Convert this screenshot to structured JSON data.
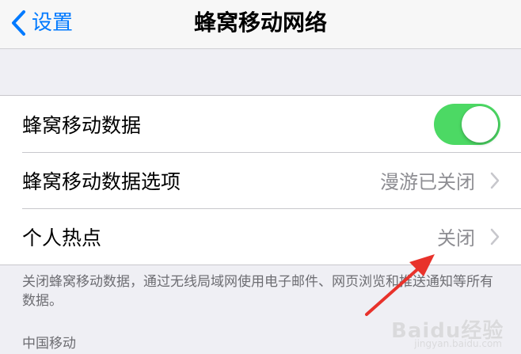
{
  "navbar": {
    "back_label": "设置",
    "title": "蜂窝移动网络"
  },
  "cellular": {
    "rows": [
      {
        "label": "蜂窝移动数据",
        "toggle_on": true
      },
      {
        "label": "蜂窝移动数据选项",
        "value": "漫游已关闭"
      },
      {
        "label": "个人热点",
        "value": "关闭"
      }
    ],
    "footer_note": "关闭蜂窝移动数据，通过无线局域网使用电子邮件、网页浏览和推送通知等所有数据。"
  },
  "carrier_section": {
    "header": "中国移动"
  },
  "watermark": {
    "brand": "Baidu经验",
    "sub": "jingyan.baidu.com"
  },
  "colors": {
    "accent": "#007aff",
    "toggle_on": "#4cd964",
    "annotation": "#e8322b"
  }
}
